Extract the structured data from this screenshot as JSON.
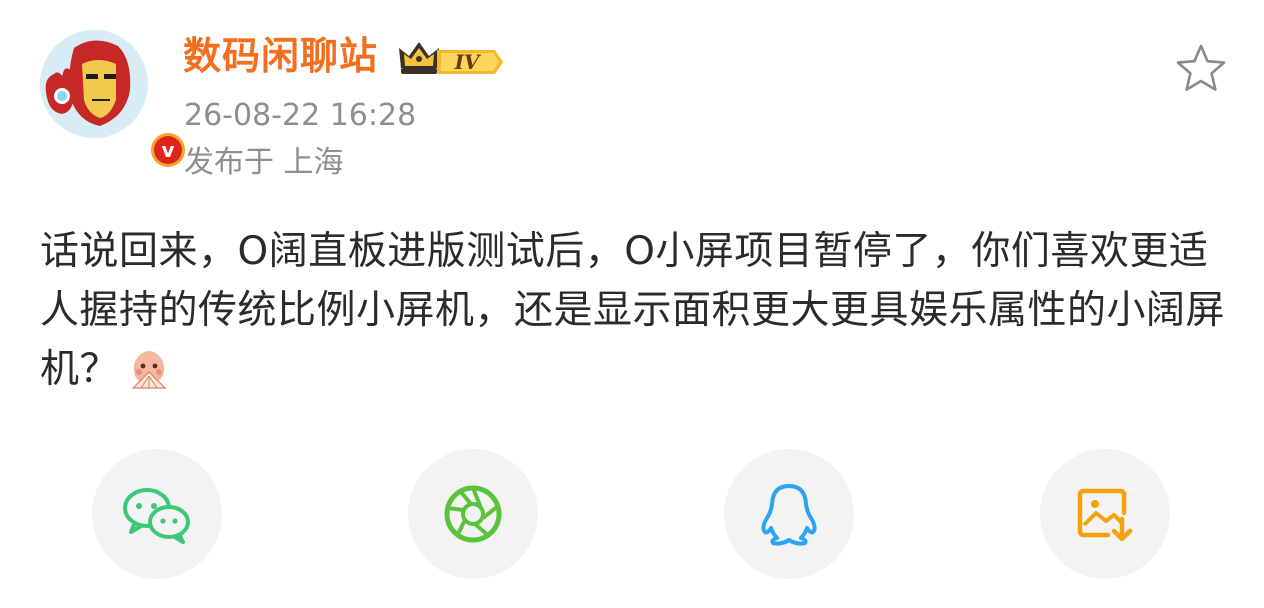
{
  "post": {
    "username": "数码闲聊站",
    "level_badge": "IV",
    "verified_mark": "v",
    "timestamp": "26-08-22 16:28",
    "location": "发布于 上海",
    "content": "话说回来，O阔直板进版测试后，O小屏项目暂停了，你们喜欢更适人握持的传统比例小屏机，还是显示面积更大更具娱乐属性的小阔屏机？",
    "emoji": "fan-face-emoji"
  },
  "icons": {
    "avatar": "iron-man-avatar",
    "favorite": "star-icon"
  },
  "share": [
    {
      "name": "wechat-share-button",
      "icon": "wechat-icon",
      "color": "#3cc878"
    },
    {
      "name": "moments-share-button",
      "icon": "moments-aperture-icon",
      "color": "#58c33b"
    },
    {
      "name": "qq-share-button",
      "icon": "qq-penguin-icon",
      "color": "#2ba3f0"
    },
    {
      "name": "save-image-button",
      "icon": "save-image-icon",
      "color": "#f6a10b"
    }
  ],
  "colors": {
    "username": "#f36f20",
    "meta_text": "#8f8f8f",
    "body_text": "#2b2b2b",
    "button_bg": "#f3f3f3"
  }
}
